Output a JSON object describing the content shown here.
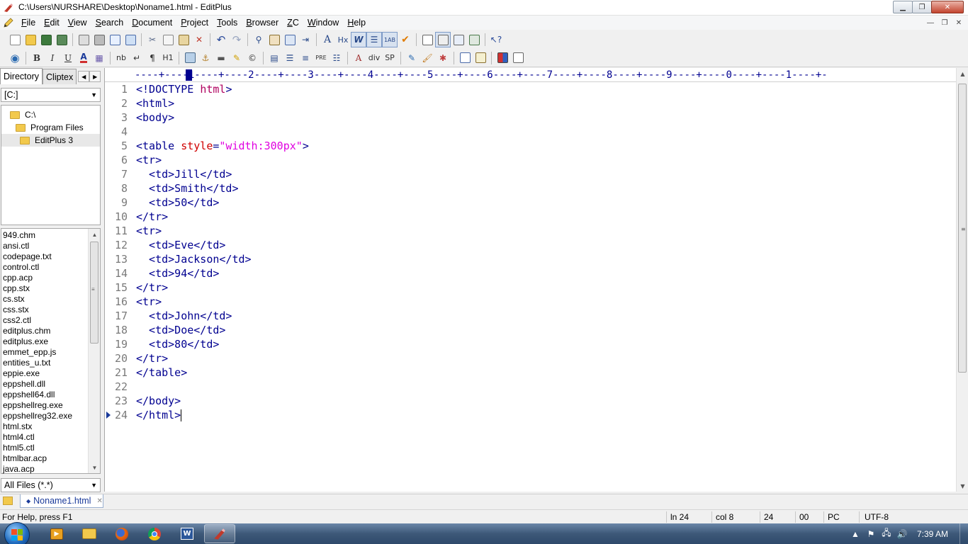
{
  "window": {
    "title": "C:\\Users\\NURSHARE\\Desktop\\Noname1.html - EditPlus"
  },
  "menu": [
    "File",
    "Edit",
    "View",
    "Search",
    "Document",
    "Project",
    "Tools",
    "Browser",
    "ZC",
    "Window",
    "Help"
  ],
  "toolbar2": {
    "bold": "B",
    "italic": "I",
    "underline": "U",
    "font_color": "A",
    "nbsp": "nb",
    "br": "↵",
    "para": "¶",
    "heading": "H1",
    "pre": "PRE",
    "div": "div",
    "span": "SP"
  },
  "toolbar1": {
    "heading_label": "Hx"
  },
  "left_panel": {
    "tabs": [
      "Directory",
      "Cliptex"
    ],
    "drive": "[C:]",
    "tree": [
      "C:\\",
      "Program Files",
      "EditPlus 3"
    ],
    "files": [
      "949.chm",
      "ansi.ctl",
      "codepage.txt",
      "control.ctl",
      "cpp.acp",
      "cpp.stx",
      "cs.stx",
      "css.stx",
      "css2.ctl",
      "editplus.chm",
      "editplus.exe",
      "emmet_epp.js",
      "entities_u.txt",
      "eppie.exe",
      "eppshell.dll",
      "eppshell64.dll",
      "eppshellreg.exe",
      "eppshellreg32.exe",
      "html.stx",
      "html4.ctl",
      "html5.ctl",
      "htmlbar.acp",
      "java.acp"
    ],
    "filter": "All Files (*.*)"
  },
  "ruler": "----+----1----+----2----+----3----+----4----+----5----+----6----+----7----+----8----+----9----+----0----+----1----+-",
  "editor": {
    "current_line": 24,
    "lines": [
      "<!DOCTYPE html>",
      "<html>",
      "<body>",
      "",
      "<table style=\"width:300px\">",
      "<tr>",
      "  <td>Jill</td>",
      "  <td>Smith</td>",
      "  <td>50</td>",
      "</tr>",
      "<tr>",
      "  <td>Eve</td>",
      "  <td>Jackson</td>",
      "  <td>94</td>",
      "</tr>",
      "<tr>",
      "  <td>John</td>",
      "  <td>Doe</td>",
      "  <td>80</td>",
      "</tr>",
      "</table>",
      "",
      "</body>",
      "</html>"
    ],
    "colors": {
      "tag": "#000090",
      "attr": "#d00000",
      "string": "#e000e0",
      "doctype_attr": "#b0005f"
    }
  },
  "document_tab": {
    "label": "Noname1.html"
  },
  "status": {
    "help": "For Help, press F1",
    "line": "ln 24",
    "col": "col 8",
    "total": "24",
    "hex": "00",
    "mode": "PC",
    "encoding": "UTF-8"
  },
  "taskbar": {
    "clock": "7:39 AM"
  }
}
